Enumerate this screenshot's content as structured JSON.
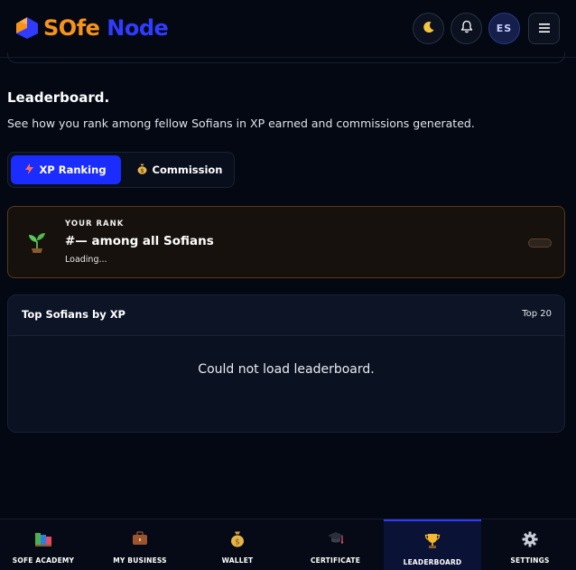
{
  "brand": {
    "word1": "SOfe",
    "word2": "Node"
  },
  "header": {
    "avatar_initials": "ES",
    "icons": [
      "moon-icon",
      "bell-icon",
      "hamburger-menu-icon"
    ]
  },
  "page": {
    "title": "Leaderboard.",
    "subtitle": "See how you rank among fellow Sofians in XP earned and commissions generated."
  },
  "tabs": [
    {
      "label": "XP Ranking",
      "icon": "lightning-icon",
      "active": true
    },
    {
      "label": "Commission",
      "icon": "money-bag-icon",
      "active": false
    }
  ],
  "rank_card": {
    "label": "YOUR RANK",
    "value": "#— among all Sofians",
    "status": "Loading...",
    "icon": "seedling-icon"
  },
  "leaderboard": {
    "title": "Top Sofians by XP",
    "badge": "Top 20",
    "empty_message": "Could not load leaderboard."
  },
  "bottom_nav": [
    {
      "label": "SOFE ACADEMY",
      "icon": "books-icon",
      "active": false
    },
    {
      "label": "MY BUSINESS",
      "icon": "briefcase-icon",
      "active": false
    },
    {
      "label": "WALLET",
      "icon": "money-bag-icon",
      "active": false
    },
    {
      "label": "CERTIFICATE",
      "icon": "graduation-cap-icon",
      "active": false
    },
    {
      "label": "LEADERBOARD",
      "icon": "trophy-icon",
      "active": true
    },
    {
      "label": "SETTINGS",
      "icon": "gear-icon",
      "active": false
    }
  ],
  "colors": {
    "background": "#030812",
    "brand_orange": "#f7931a",
    "brand_blue": "#2f3cff",
    "active_tab": "#1b2cff",
    "rank_border": "#5a3a14"
  }
}
